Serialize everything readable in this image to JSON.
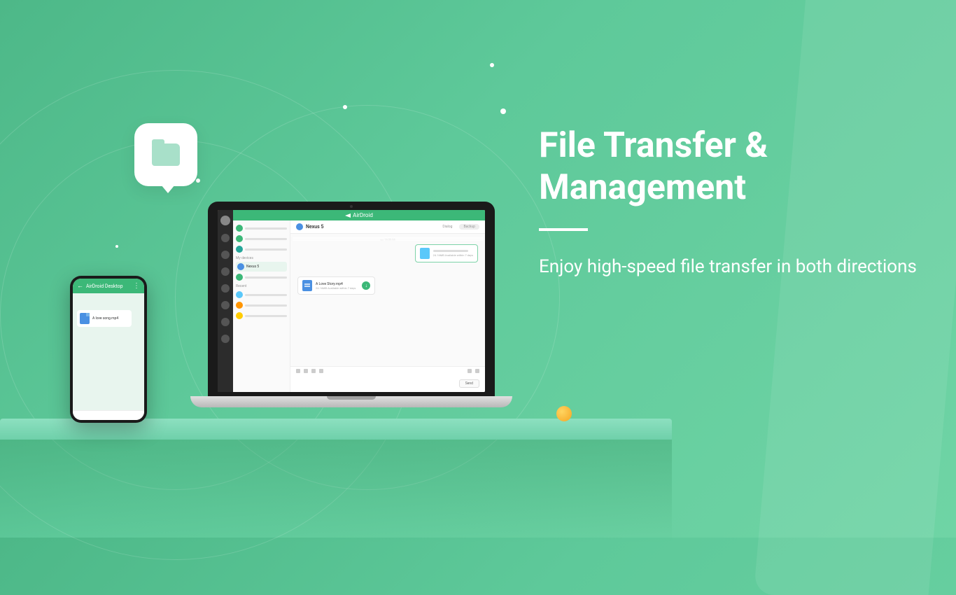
{
  "hero": {
    "title": "File Transfer & Management",
    "subtitle": "Enjoy high-speed file transfer in both directions"
  },
  "laptop": {
    "app_name": "AirDroid",
    "chat_contact": "Nexus 5",
    "tabs": {
      "dialog": "Dialog",
      "backup": "Backup"
    },
    "timestamp": "we 18 22:33",
    "sections": {
      "my_devices": "My devices",
      "recent": "Recent"
    },
    "contact_nexus": "Nexus 5",
    "outgoing": {
      "meta": "24.16MB   Available within 7 days"
    },
    "incoming": {
      "filename": "A Love Story.mp4",
      "meta": "24.16MB   Available within 7 days"
    },
    "send_label": "Send"
  },
  "phone": {
    "title": "AirDroid Desktop",
    "message": "A love song.mp4"
  }
}
